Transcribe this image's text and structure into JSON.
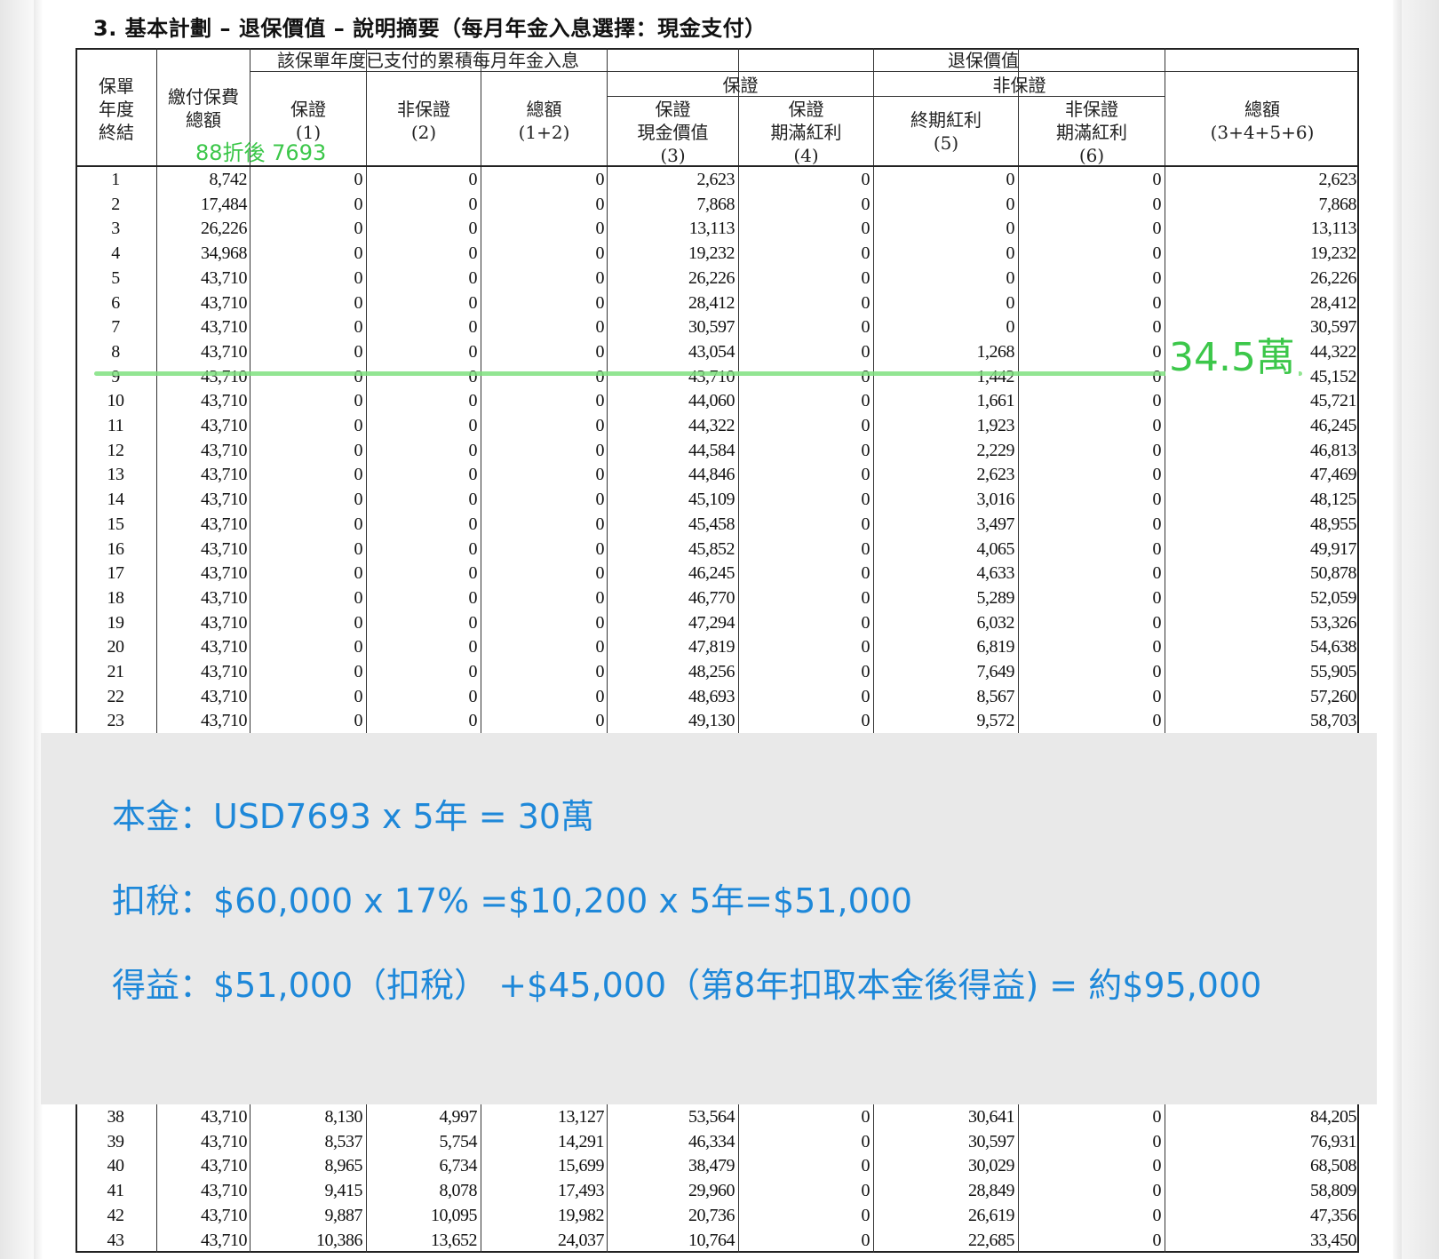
{
  "document": {
    "title": "3. 基本計劃 – 退保價值 – 說明摘要（每月年金入息選擇：現金支付）"
  },
  "table": {
    "headers": {
      "policy_year_end": "保單\n年度\n終結",
      "total_premium": "繳付保費\n總額",
      "paid_income_group": "該保單年度已支付的累積每月年金入息",
      "guaranteed_1": "保證\n(1)",
      "non_guaranteed_2": "非保證\n(2)",
      "total_1_2": "總額\n(1+2)",
      "surrender_value_group": "退保價值",
      "guaranteed_group": "保證",
      "non_guaranteed_group": "非保證",
      "guaranteed_cash_value_3": "保證\n現金價值\n(3)",
      "guaranteed_maturity_bonus_4": "保證\n期滿紅利\n(4)",
      "terminal_bonus_5": "終期紅利\n(5)",
      "non_guaranteed_maturity_bonus_6": "非保證\n期滿紅利\n(6)",
      "total_3_4_5_6": "總額\n(3+4+5+6)"
    },
    "rows_top": [
      [
        "1",
        "8,742",
        "0",
        "0",
        "0",
        "2,623",
        "0",
        "0",
        "0",
        "2,623"
      ],
      [
        "2",
        "17,484",
        "0",
        "0",
        "0",
        "7,868",
        "0",
        "0",
        "0",
        "7,868"
      ],
      [
        "3",
        "26,226",
        "0",
        "0",
        "0",
        "13,113",
        "0",
        "0",
        "0",
        "13,113"
      ],
      [
        "4",
        "34,968",
        "0",
        "0",
        "0",
        "19,232",
        "0",
        "0",
        "0",
        "19,232"
      ],
      [
        "5",
        "43,710",
        "0",
        "0",
        "0",
        "26,226",
        "0",
        "0",
        "0",
        "26,226"
      ],
      [
        "6",
        "43,710",
        "0",
        "0",
        "0",
        "28,412",
        "0",
        "0",
        "0",
        "28,412"
      ],
      [
        "7",
        "43,710",
        "0",
        "0",
        "0",
        "30,597",
        "0",
        "0",
        "0",
        "30,597"
      ],
      [
        "8",
        "43,710",
        "0",
        "0",
        "0",
        "43,054",
        "0",
        "1,268",
        "0",
        "44,322"
      ],
      [
        "9",
        "43,710",
        "0",
        "0",
        "0",
        "43,710",
        "0",
        "1,442",
        "0",
        "45,152"
      ],
      [
        "10",
        "43,710",
        "0",
        "0",
        "0",
        "44,060",
        "0",
        "1,661",
        "0",
        "45,721"
      ],
      [
        "11",
        "43,710",
        "0",
        "0",
        "0",
        "44,322",
        "0",
        "1,923",
        "0",
        "46,245"
      ],
      [
        "12",
        "43,710",
        "0",
        "0",
        "0",
        "44,584",
        "0",
        "2,229",
        "0",
        "46,813"
      ],
      [
        "13",
        "43,710",
        "0",
        "0",
        "0",
        "44,846",
        "0",
        "2,623",
        "0",
        "47,469"
      ],
      [
        "14",
        "43,710",
        "0",
        "0",
        "0",
        "45,109",
        "0",
        "3,016",
        "0",
        "48,125"
      ],
      [
        "15",
        "43,710",
        "0",
        "0",
        "0",
        "45,458",
        "0",
        "3,497",
        "0",
        "48,955"
      ],
      [
        "16",
        "43,710",
        "0",
        "0",
        "0",
        "45,852",
        "0",
        "4,065",
        "0",
        "49,917"
      ],
      [
        "17",
        "43,710",
        "0",
        "0",
        "0",
        "46,245",
        "0",
        "4,633",
        "0",
        "50,878"
      ],
      [
        "18",
        "43,710",
        "0",
        "0",
        "0",
        "46,770",
        "0",
        "5,289",
        "0",
        "52,059"
      ],
      [
        "19",
        "43,710",
        "0",
        "0",
        "0",
        "47,294",
        "0",
        "6,032",
        "0",
        "53,326"
      ],
      [
        "20",
        "43,710",
        "0",
        "0",
        "0",
        "47,819",
        "0",
        "6,819",
        "0",
        "54,638"
      ],
      [
        "21",
        "43,710",
        "0",
        "0",
        "0",
        "48,256",
        "0",
        "7,649",
        "0",
        "55,905"
      ],
      [
        "22",
        "43,710",
        "0",
        "0",
        "0",
        "48,693",
        "0",
        "8,567",
        "0",
        "57,260"
      ],
      [
        "23",
        "43,710",
        "0",
        "0",
        "0",
        "49,130",
        "0",
        "9,572",
        "0",
        "58,703"
      ]
    ],
    "rows_bottom": [
      [
        "38",
        "43,710",
        "8,130",
        "4,997",
        "13,127",
        "53,564",
        "0",
        "30,641",
        "0",
        "84,205"
      ],
      [
        "39",
        "43,710",
        "8,537",
        "5,754",
        "14,291",
        "46,334",
        "0",
        "30,597",
        "0",
        "76,931"
      ],
      [
        "40",
        "43,710",
        "8,965",
        "6,734",
        "15,699",
        "38,479",
        "0",
        "30,029",
        "0",
        "68,508"
      ],
      [
        "41",
        "43,710",
        "9,415",
        "8,078",
        "17,493",
        "29,960",
        "0",
        "28,849",
        "0",
        "58,809"
      ],
      [
        "42",
        "43,710",
        "9,887",
        "10,095",
        "19,982",
        "20,736",
        "0",
        "26,619",
        "0",
        "47,356"
      ],
      [
        "43",
        "43,710",
        "10,386",
        "13,652",
        "24,037",
        "10,764",
        "0",
        "22,685",
        "0",
        "33,450"
      ]
    ]
  },
  "annotations": {
    "discount_note": "88折後 7693",
    "value_note": "34.5萬",
    "green_color": "#3cc74a"
  },
  "overlay": {
    "principal": "本金：USD7693 x 5年 = 30萬",
    "tax": "扣稅：$60,000 x 17% =$10,200 x 5年=$51,000",
    "gain": "得益：$51,000（扣稅） +$45,000（第8年扣取本金後得益) = 約$95,000",
    "text_color": "#1e88d9"
  }
}
